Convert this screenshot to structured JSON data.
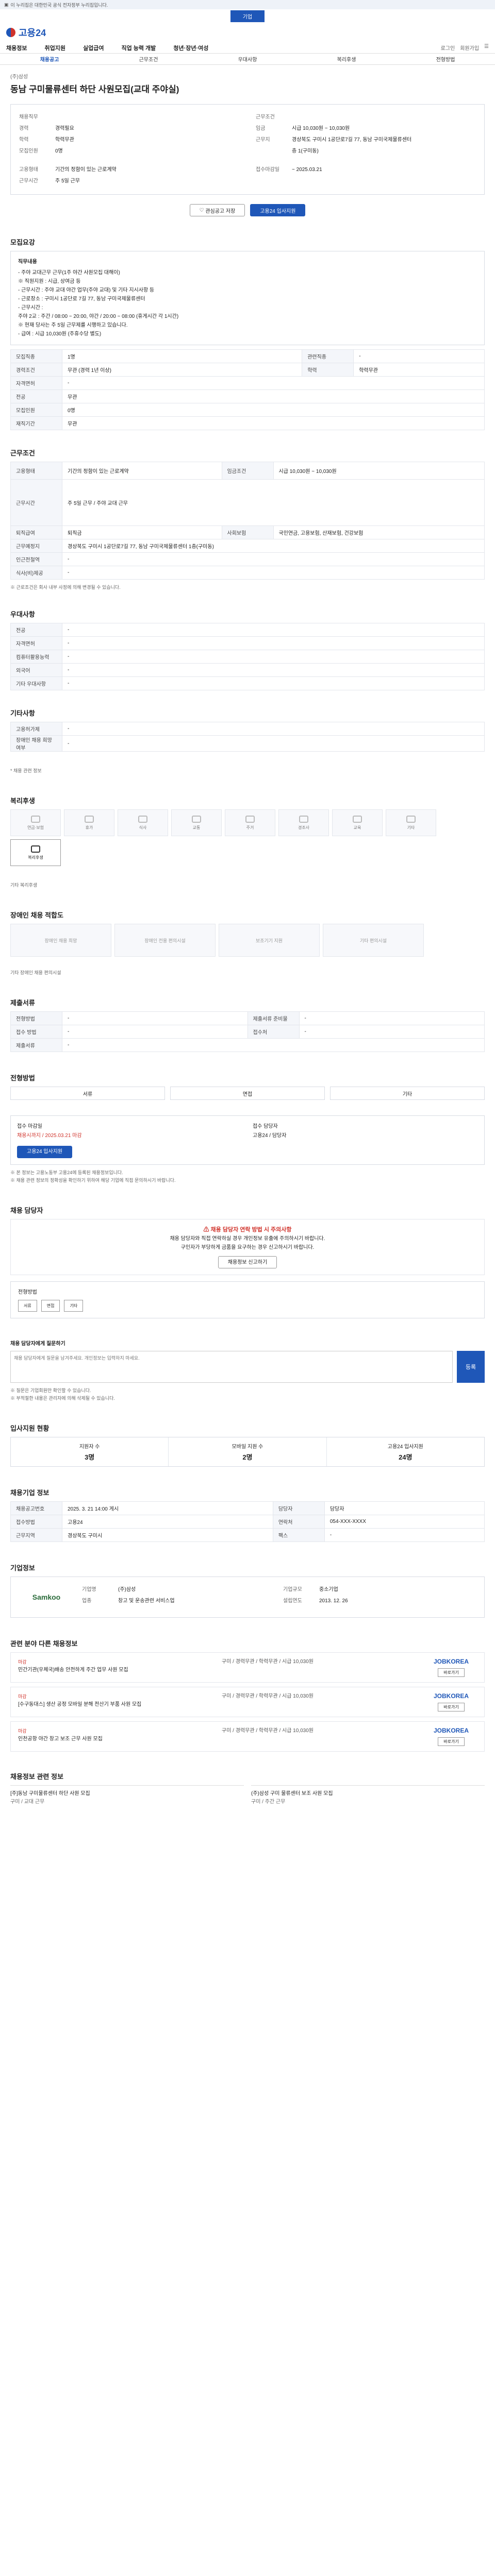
{
  "banner": "이 누리집은 대한민국 공식 전자정부 누리집입니다.",
  "top_pill": "기업",
  "logo": "고용24",
  "gnb": [
    "채용정보",
    "취업지원",
    "실업급여",
    "직업 능력 개발",
    "청년·장년·여성"
  ],
  "gnb_right": [
    "로그인",
    "회원가입"
  ],
  "tabs": [
    "채용공고",
    "근무조건",
    "우대사항",
    "복리후생",
    "전형방법"
  ],
  "company": "(주)삼성",
  "title": "동남 구미물류센터 하단 사원모집(교대 주야실)",
  "summary": {
    "left": [
      {
        "k": "채용직무",
        "v": ""
      },
      {
        "k": "경력",
        "v": "경력필요"
      },
      {
        "k": "학력",
        "v": "학력무관"
      },
      {
        "k": "모집인원",
        "v": "0명"
      }
    ],
    "right": [
      {
        "k": "근무조건",
        "v": ""
      },
      {
        "k": "임금",
        "v": "시급 10,030원 ~ 10,030원"
      },
      {
        "k": "근무지",
        "v": "경상북도 구미시 1공단로7길 77, 동남 구미국제물류센터"
      },
      {
        "k": "",
        "v": "층 1(구미동)"
      }
    ],
    "row2_left": [
      {
        "k": "고용형태",
        "v": "기간의 정함이 있는 근로계약"
      },
      {
        "k": "근무시간",
        "v": "주 5일 근무"
      }
    ],
    "row2_right": [
      {
        "k": "접수마감일",
        "v": "~ 2025.03.21"
      }
    ]
  },
  "buttons": {
    "save": "관심공고 저장",
    "apply": "고용24 입사지원"
  },
  "section_recruit": {
    "title": "모집요강",
    "content_title": "직무내용",
    "lines": [
      "- 주야 교대근무 근무(1주 야간 사원모집 대해이)",
      "※ 직원지원 : 시급, 상여금 등",
      "- 근무시간 : 주야 교대 야간 업무(주야 교대) 및 기타 지시사항 등",
      "- 근로장소 : 구미시 1공단로 7길 77, 동남 구미국제물류센터",
      "- 근무시간 :",
      "  주야 2교 : 주간 / 08:00 ~ 20:00, 야간 / 20:00 ~ 08:00 (휴게시간 각 1시간)",
      "  ※ 현재 당사는 주 5일 근무제를 시행하고 있습니다.",
      "- 급여 : 시급 10,030원 (주휴수당 별도)"
    ],
    "rows": [
      {
        "k": "모집직종",
        "v": "1명",
        "k2": "관련직종",
        "v2": "-"
      },
      {
        "k": "경력조건",
        "v": "무관 (경력 1년 이상)",
        "k2": "학력",
        "v2": "학력무관"
      },
      {
        "k": "자격면허",
        "v": "-",
        "k2": "",
        "v2": ""
      },
      {
        "k": "전공",
        "v": "무관",
        "k2": "",
        "v2": ""
      },
      {
        "k": "모집인원",
        "v": "0명",
        "k2": "",
        "v2": ""
      },
      {
        "k": "재직기간",
        "v": "무관",
        "k2": "",
        "v2": ""
      }
    ]
  },
  "section_condition": {
    "title": "근무조건",
    "rows": [
      {
        "k": "고용형태",
        "v": "기간의 정함이 있는 근로계약",
        "k2": "임금조건",
        "v2": "시급 10,030원 ~ 10,030원"
      },
      {
        "k": "근무시간",
        "v": "주 5일 근무 / 주야 교대 근무",
        "k2": "",
        "v2": ""
      },
      {
        "k": "퇴직급여",
        "v": "퇴직금",
        "k2": "사회보험",
        "v2": "국민연금, 고용보험, 산재보험, 건강보험"
      },
      {
        "k": "근무예정지",
        "v": "경상북도 구미시 1공단로7길 77, 동남 구미국제물류센터 1층(구미동)",
        "k2": "",
        "v2": ""
      },
      {
        "k": "인근전철역",
        "v": "-",
        "k2": "",
        "v2": ""
      },
      {
        "k": "식사(비)제공",
        "v": "-",
        "k2": "",
        "v2": ""
      }
    ],
    "note": "※ 근로조건은 회사 내부 사정에 의해 변경될 수 있습니다."
  },
  "section_pref": {
    "title": "우대사항",
    "rows": [
      {
        "k": "전공",
        "v": "-"
      },
      {
        "k": "자격면허",
        "v": "-"
      },
      {
        "k": "컴퓨터활용능력",
        "v": "-"
      },
      {
        "k": "외국어",
        "v": "-"
      },
      {
        "k": "기타 우대사항",
        "v": "-"
      }
    ]
  },
  "section_other": {
    "title": "기타사항",
    "rows": [
      {
        "k": "고용허가제",
        "v": "-"
      },
      {
        "k": "장애인 채용 희망여부",
        "v": "-"
      }
    ],
    "note": "* 채용 관련 정보"
  },
  "section_welfare": {
    "title": "복리후생",
    "cards": [
      "연금·보험",
      "휴가",
      "식사",
      "교통",
      "주거",
      "경조사",
      "교육",
      "기타",
      "복리후생"
    ],
    "note": "기타 복리후생"
  },
  "section_disability": {
    "title": "장애인 채용 적합도",
    "cards": [
      "장애인 채용 희망",
      "장애인 전용 편의시설",
      "보조기기 지원",
      "기타 편의시설"
    ],
    "note": "기타 장애인 채용 편의시설"
  },
  "section_docs": {
    "title": "제출서류",
    "rows": [
      {
        "k": "전형방법",
        "v": "-",
        "k2": "제출서류 준비물",
        "v2": "-"
      },
      {
        "k": "접수 방법",
        "v": "-",
        "k2": "접수처",
        "v2": "-"
      },
      {
        "k": "제출서류",
        "v": "-",
        "k2": "",
        "v2": ""
      }
    ]
  },
  "section_method": {
    "title": "전형방법",
    "options": [
      "서류",
      "면접",
      "기타"
    ]
  },
  "section_apply": {
    "title": "",
    "deadline_label": "접수 마감일",
    "deadline": "채용시까지 / 2025.03.21 마감",
    "contact_label": "접수 담당자",
    "contact": "고용24 / 담당자",
    "apply_button": "고용24 입사지원",
    "notes": [
      "※ 본 정보는 고용노동부 고용24에 등록된 채용정보입니다.",
      "※ 채용 관련 정보의 정확성을 확인하기 위하여 해당 기업에 직접 문의하시기 바랍니다."
    ]
  },
  "section_warn": {
    "title": "채용 담당자",
    "head": "채용 담당자 연락 방법 시 주의사항",
    "lines": [
      "채용 담당자와 직접 연락하실 경우 개인정보 유출에 주의하시기 바랍니다.",
      "구인자가 부당하게 금품을 요구하는 경우 신고하시기 바랍니다."
    ],
    "button": "채용정보 신고하기",
    "sub_title": "전형방법",
    "sub_items": [
      "서류",
      "면접",
      "기타"
    ]
  },
  "section_comment": {
    "title": "채용 담당자에게 질문하기",
    "placeholder": "채용 담당자에게 질문을 남겨주세요. 개인정보는 입력하지 마세요.",
    "button": "등록",
    "notes": [
      "※ 질문은 기업회원만 확인할 수 있습니다.",
      "※ 부적절한 내용은 관리자에 의해 삭제될 수 있습니다."
    ]
  },
  "section_stats": {
    "title": "입사지원 현황",
    "items": [
      {
        "label": "지원자 수",
        "value": "3명"
      },
      {
        "label": "모바일 지원 수",
        "value": "2명"
      },
      {
        "label": "고용24 입사지원",
        "value": "24명"
      }
    ]
  },
  "section_info": {
    "title": "채용기업 정보",
    "rows": [
      {
        "k": "채용공고번호",
        "v": "2025. 3. 21 14:00 게시",
        "k2": "담당자",
        "v2": "담당자"
      },
      {
        "k": "접수방법",
        "v": "고용24",
        "k2": "연락처",
        "v2": "054-XXX-XXXX"
      },
      {
        "k": "근무지역",
        "v": "경상북도 구미시",
        "k2": "팩스",
        "v2": "-"
      }
    ]
  },
  "section_company": {
    "title": "기업정보",
    "logo": "Samkoo",
    "rows": [
      {
        "k": "기업명",
        "v": "(주)삼성"
      },
      {
        "k": "업종",
        "v": "창고 및 운송관련 서비스업"
      },
      {
        "k": "기업규모",
        "v": "중소기업"
      },
      {
        "k": "설립연도",
        "v": "2013. 12. 26"
      }
    ]
  },
  "section_related": {
    "title": "관련 분야 다른 채용정보",
    "items": [
      {
        "badge": "마감",
        "title": "민간기관(우체국)배송 안전하게 주간 업무 사원 모집",
        "meta": "구미 / 경력무관 / 학력무관 / 시급 10,030원",
        "logo": "JOBKOREA",
        "btn": "바로가기"
      },
      {
        "badge": "마감",
        "title": "[수구동대스] 생산 공정 모바일 분해 전산기 부품 사원 모집",
        "meta": "구미 / 경력무관 / 학력무관 / 시급 10,030원",
        "logo": "JOBKOREA",
        "btn": "바로가기"
      },
      {
        "badge": "마감",
        "title": "인천공항 야간 창고 보조 근무 사원 모집",
        "meta": "구미 / 경력무관 / 학력무관 / 시급 10,030원",
        "logo": "JOBKOREA",
        "btn": "바로가기"
      }
    ]
  },
  "section_more": {
    "title": "채용정보 관련 정보",
    "items": [
      {
        "title": "[주]동남 구미물류센터 하단 사원 모집",
        "meta": "구미 / 교대 근무"
      },
      {
        "title": "(주)삼성 구미 물류센터 보조 사원 모집",
        "meta": "구미 / 주간 근무"
      }
    ]
  }
}
